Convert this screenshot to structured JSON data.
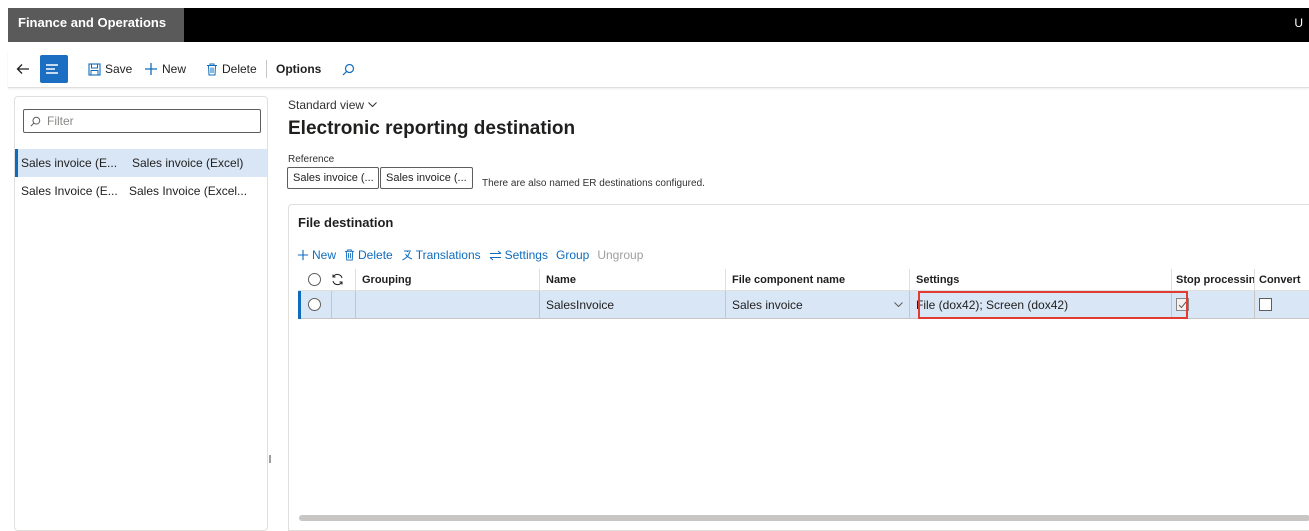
{
  "app": {
    "title": "Finance and Operations",
    "user_initial": "U"
  },
  "actionpane": {
    "save": "Save",
    "new": "New",
    "delete": "Delete",
    "options": "Options"
  },
  "left": {
    "filter_placeholder": "Filter",
    "items": [
      {
        "col1": "Sales invoice (E...",
        "col2": "Sales invoice (Excel)"
      },
      {
        "col1": "Sales Invoice (E...",
        "col2": "Sales Invoice (Excel..."
      }
    ]
  },
  "main": {
    "view": "Standard view",
    "title": "Electronic reporting destination",
    "reference_label": "Reference",
    "reference_buttons": [
      "Sales invoice (...",
      "Sales invoice (..."
    ],
    "reference_note": "There are also named ER destinations configured."
  },
  "card": {
    "title": "File destination",
    "toolbar": {
      "new": "New",
      "delete": "Delete",
      "translations": "Translations",
      "settings": "Settings",
      "group": "Group",
      "ungroup": "Ungroup"
    },
    "columns": {
      "grouping": "Grouping",
      "name": "Name",
      "file_component": "File component name",
      "settings": "Settings",
      "stop": "Stop processin...",
      "convert": "Convert"
    },
    "row": {
      "grouping": "",
      "name": "SalesInvoice",
      "file_component": "Sales invoice",
      "settings": "File (dox42); Screen (dox42)",
      "stop_processing": true,
      "convert": false
    }
  },
  "colors": {
    "accent": "#0f6cbd",
    "highlight": "#e03c31",
    "selected_row": "#d9e6f5"
  }
}
